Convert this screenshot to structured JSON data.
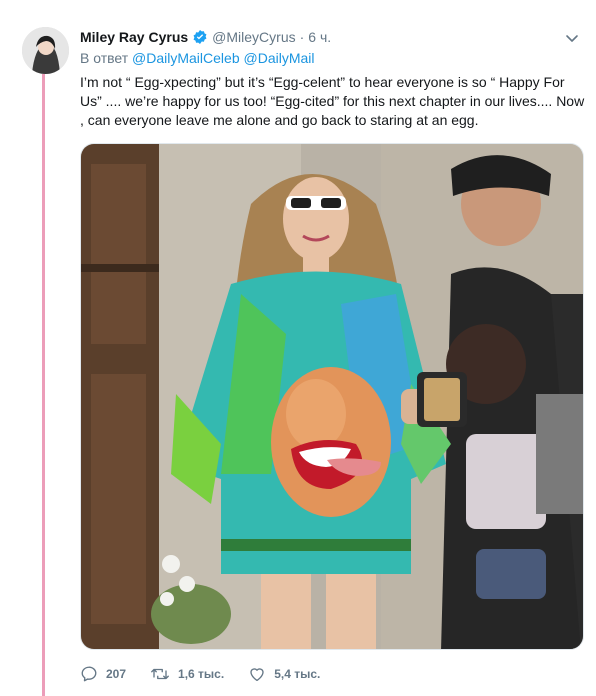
{
  "tweet": {
    "display_name": "Miley Ray Cyrus",
    "handle": "@MileyCyrus",
    "separator": "·",
    "time": "6 ч.",
    "reply_prefix": "В ответ",
    "reply_to": [
      "@DailyMailCeleb",
      "@DailyMail"
    ],
    "text": "I’m not “ Egg-xpecting” but it’s “Egg-celent” to hear everyone is so “ Happy For Us” .... we’re happy for us too! “Egg-cited” for this next chapter in our lives.... Now , can everyone leave me alone and go back to staring at an egg."
  },
  "actions": {
    "replies": "207",
    "retweets": "1,6 тыс.",
    "likes": "5,4 тыс."
  },
  "icons": {
    "verified": "verified-badge-icon",
    "more": "chevron-down-icon",
    "reply": "reply-icon",
    "retweet": "retweet-icon",
    "like": "heart-icon"
  },
  "colors": {
    "thread_line": "#ec9db9",
    "link": "#1b95e0",
    "secondary_text": "#657786",
    "verified": "#1da1f2"
  }
}
